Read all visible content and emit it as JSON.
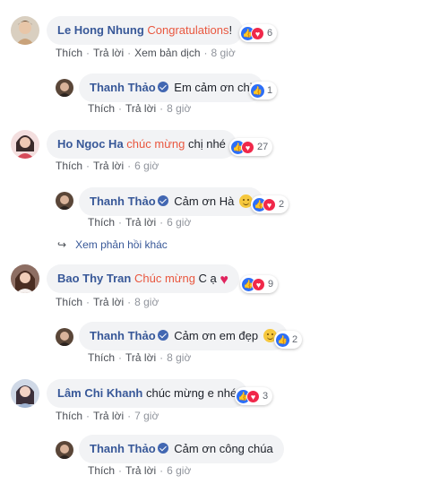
{
  "comments": [
    {
      "author": "Le Hong Nhung",
      "highlight": "Congratulations",
      "text": "!",
      "reactions": "6",
      "actions": {
        "like": "Thích",
        "reply": "Trả lời",
        "translate": "Xem bản dịch",
        "time": "8 giờ"
      }
    },
    {
      "author": "Thanh Thảo",
      "text": "Em cảm ơn chị",
      "reactions": "1",
      "actions": {
        "like": "Thích",
        "reply": "Trả lời",
        "time": "8 giờ"
      }
    },
    {
      "author": "Ho Ngoc Ha",
      "highlight": "chúc mừng",
      "text": " chị nhé",
      "reactions": "27",
      "actions": {
        "like": "Thích",
        "reply": "Trả lời",
        "time": "6 giờ"
      }
    },
    {
      "author": "Thanh Thảo",
      "text": "Cảm ơn Hà",
      "reactions": "2",
      "actions": {
        "like": "Thích",
        "reply": "Trả lời",
        "time": "6 giờ"
      }
    },
    {
      "author": "Bao Thy Tran",
      "highlight": "Chúc mừng",
      "text": " C ạ",
      "reactions": "9",
      "actions": {
        "like": "Thích",
        "reply": "Trả lời",
        "time": "8 giờ"
      }
    },
    {
      "author": "Thanh Thảo",
      "text": "Cảm ơn em đẹp",
      "reactions": "2",
      "actions": {
        "like": "Thích",
        "reply": "Trả lời",
        "time": "8 giờ"
      }
    },
    {
      "author": "Lâm Chi Khanh",
      "text": "chúc mừng e nhé",
      "reactions": "3",
      "actions": {
        "like": "Thích",
        "reply": "Trả lời",
        "time": "7 giờ"
      }
    },
    {
      "author": "Thanh Thảo",
      "text": "Cảm ơn công chúa",
      "actions": {
        "like": "Thích",
        "reply": "Trả lời",
        "time": "6 giờ"
      }
    }
  ],
  "more_replies": "Xem phản hồi khác",
  "colors": {
    "author": "#385898",
    "highlight": "#e9573f",
    "bubble": "#f2f3f5",
    "like": "#2d6ff7",
    "love": "#f0284a"
  }
}
